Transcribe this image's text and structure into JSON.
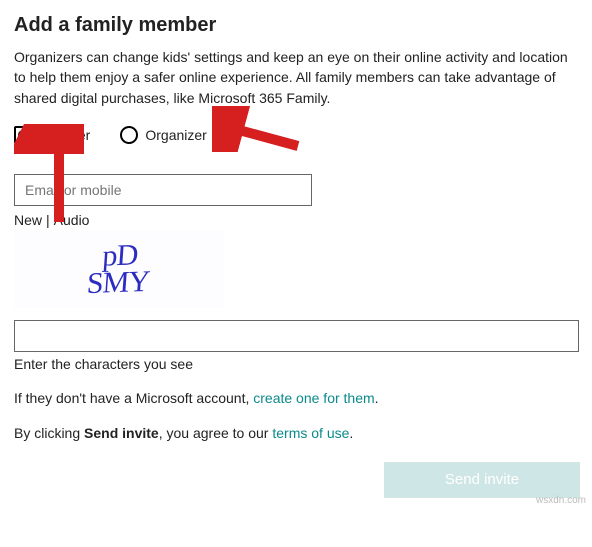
{
  "title": "Add a family member",
  "description": "Organizers can change kids' settings and keep an eye on their online activity and location to help them enjoy a safer online experience. All family members can take advantage of shared digital purchases, like Microsoft 365 Family.",
  "role": {
    "member_label": "Member",
    "organizer_label": "Organizer",
    "selected": "member"
  },
  "email": {
    "value": "",
    "placeholder": "Email or mobile"
  },
  "captcha": {
    "new_label": "New",
    "audio_label": "Audio",
    "image_text": "pD\nSMY",
    "input_value": "",
    "input_label": "Enter the characters you see"
  },
  "no_account": {
    "prefix": "If they don't have a Microsoft account, ",
    "link_text": "create one for them",
    "suffix": "."
  },
  "terms": {
    "prefix": "By clicking ",
    "bold": "Send invite",
    "middle": ", you agree to our ",
    "link_text": "terms of use",
    "suffix": "."
  },
  "submit_label": "Send invite",
  "watermark": "wsxdn.com",
  "colors": {
    "link": "#0b8a8a",
    "button_bg": "#cfe6e6",
    "arrow": "#d61f1f"
  }
}
